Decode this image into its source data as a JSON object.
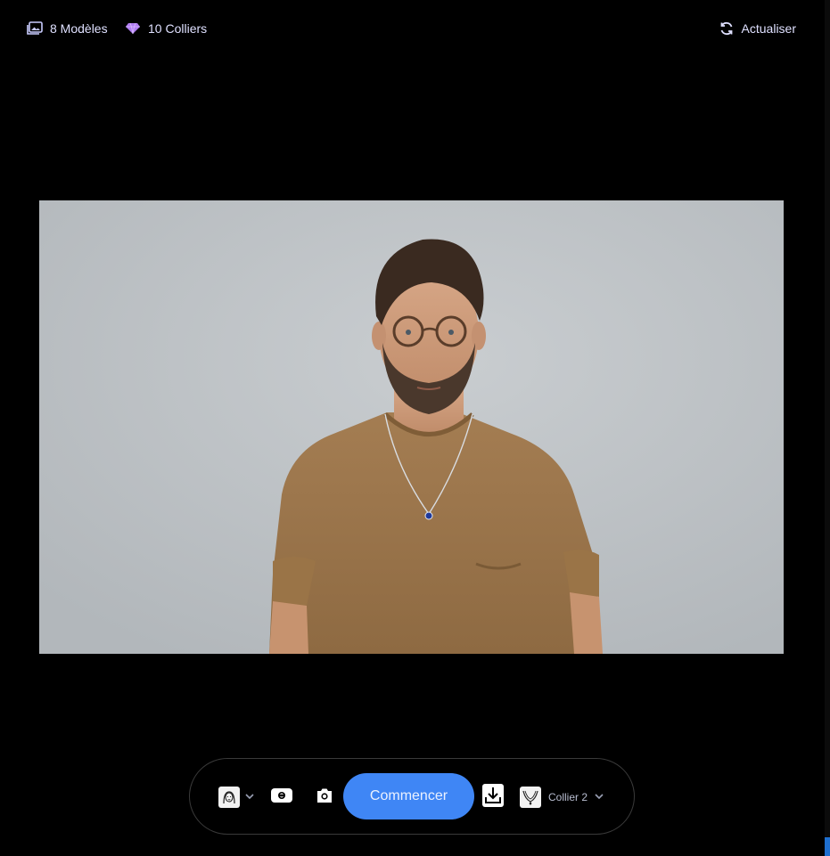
{
  "header": {
    "models_count_label": "8 Modèles",
    "necklaces_count_label": "10 Colliers",
    "refresh_label": "Actualiser",
    "icons": {
      "models": "images-icon",
      "necklaces": "diamond-icon",
      "refresh": "refresh-icon"
    }
  },
  "preview": {
    "image_alt": "Homme portant un collier avec pendentif bleu"
  },
  "toolbar": {
    "start_label": "Commencer",
    "necklace_selected": "Collier 2",
    "icons": {
      "model_picker": "face-thumbnail-icon",
      "camera_switch": "camera-switch-icon",
      "snapshot": "camera-icon",
      "download": "download-icon",
      "necklace_thumb": "necklace-icon",
      "chevron": "chevron-down-icon"
    }
  },
  "colors": {
    "accent": "#3f86f5",
    "background": "#000000",
    "text": "#dfe0ff",
    "diamond": "#b07cf2"
  }
}
